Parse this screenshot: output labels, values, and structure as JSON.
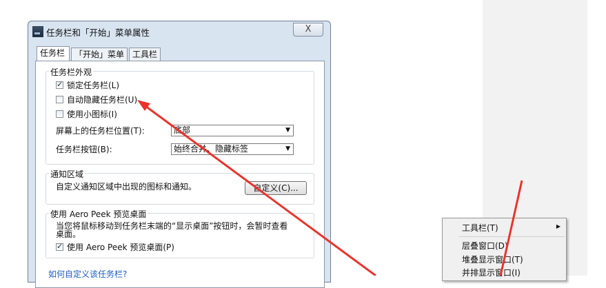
{
  "dialog": {
    "title": "任务栏和「开始」菜单属性",
    "close_label": "X",
    "tabs": [
      {
        "label": "任务栏"
      },
      {
        "label": "「开始」菜单"
      },
      {
        "label": "工具栏"
      }
    ],
    "appearance": {
      "title": "任务栏外观",
      "lock_label": "锁定任务栏(L)",
      "autohide_label": "自动隐藏任务栏(U)",
      "small_icons_label": "使用小图标(I)",
      "location_label": "屏幕上的任务栏位置(T):",
      "location_value": "底部",
      "buttons_label": "任务栏按钮(B):",
      "buttons_value": "始终合并、隐藏标签"
    },
    "notification": {
      "title": "通知区域",
      "desc": "自定义通知区域中出现的图标和通知。",
      "customize_label": "自定义(C)..."
    },
    "aero": {
      "title": "使用 Aero Peek 预览桌面",
      "desc_line1": "当您将鼠标移动到任务栏末端的“显示桌面”按钮时，会暂时查看",
      "desc_line2": "桌面。",
      "checkbox_label": "使用 Aero Peek 预览桌面(P)"
    },
    "help_link": "如何自定义该任务栏?"
  },
  "context_menu": {
    "items": [
      {
        "label": "工具栏(T)"
      },
      {
        "label": "层叠窗口(D)"
      },
      {
        "label": "堆叠显示窗口(T)"
      },
      {
        "label": "并排显示窗口(I)"
      }
    ]
  },
  "colors": {
    "arrow": "#e8342c",
    "link": "#1a5dbf"
  }
}
